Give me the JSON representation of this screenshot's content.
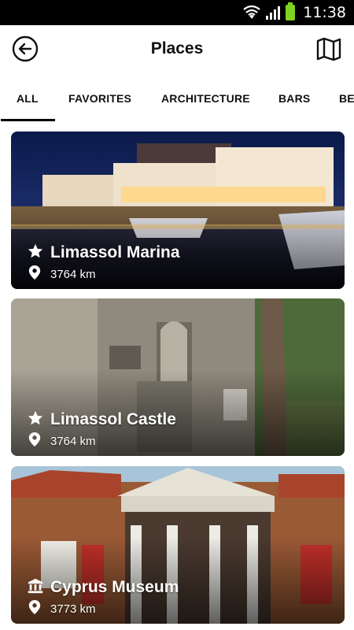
{
  "status": {
    "time": "11:38"
  },
  "header": {
    "title": "Places",
    "back_icon": "back-arrow-icon",
    "map_icon": "map-icon"
  },
  "tabs": [
    {
      "label": "ALL",
      "active": true
    },
    {
      "label": "FAVORITES",
      "active": false
    },
    {
      "label": "ARCHITECTURE",
      "active": false
    },
    {
      "label": "BARS",
      "active": false
    },
    {
      "label": "BE",
      "active": false
    }
  ],
  "places": [
    {
      "name": "Limassol Marina",
      "distance": "3764 km",
      "icon": "star-icon"
    },
    {
      "name": "Limassol Castle",
      "distance": "3764 km",
      "icon": "star-icon"
    },
    {
      "name": "Cyprus Museum",
      "distance": "3773 km",
      "icon": "museum-icon"
    }
  ]
}
